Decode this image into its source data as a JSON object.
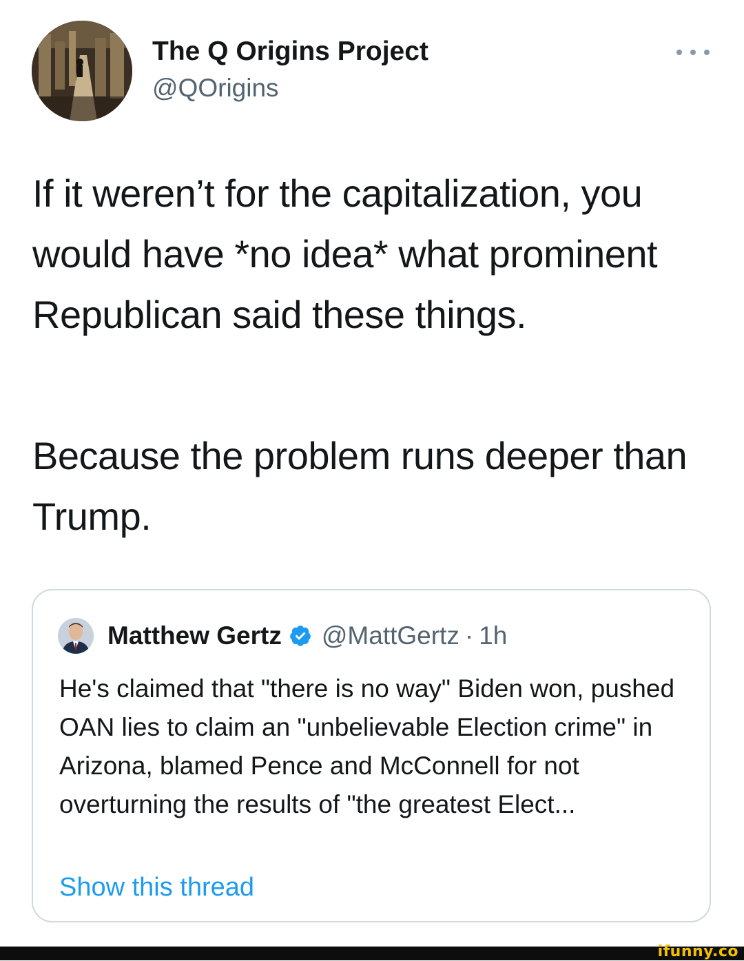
{
  "tweet": {
    "author": {
      "name": "The Q Origins Project",
      "handle": "@QOrigins"
    },
    "paragraphs": [
      "If it weren’t for the capitalization, you would have *no idea* what prominent Republican said these things.",
      "Because the problem runs deeper than Trump."
    ],
    "more_icon": "more-horizontal-icon"
  },
  "quote": {
    "author": {
      "name": "Matthew Gertz",
      "handle": "@MattGertz",
      "separator": "·",
      "time": "1h",
      "verified": true
    },
    "text": "He's claimed that \"there is no way\" Biden won, pushed OAN lies to claim an \"unbelievable Election crime\" in Arizona, blamed Pence and McConnell for not overturning the results of \"the greatest Elect...",
    "show_thread_label": "Show this thread"
  },
  "footer": {
    "watermark": "ifunny.co"
  },
  "colors": {
    "text_primary": "#14171a",
    "text_secondary": "#536471",
    "link": "#1d9bf0",
    "border": "#cfd9de",
    "verified": "#1d9bf0",
    "watermark": "#f2c200"
  }
}
